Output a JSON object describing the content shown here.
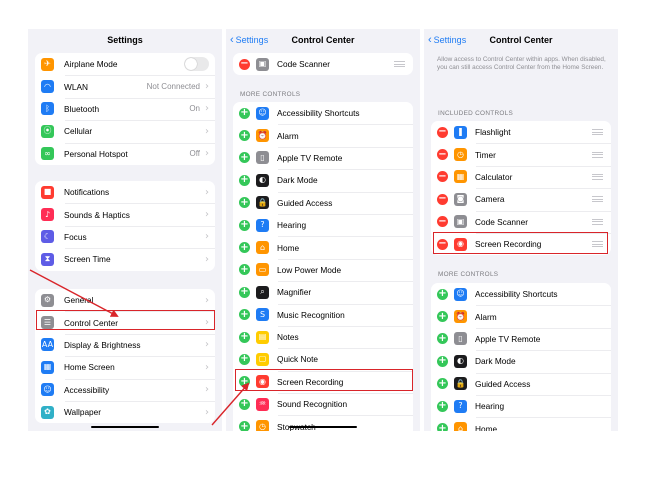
{
  "screen1": {
    "title": "Settings",
    "group1": [
      {
        "label": "Airplane Mode",
        "icon": "airplane-icon",
        "color": "#ff9500",
        "glyph": "✈",
        "toggle": true
      },
      {
        "label": "WLAN",
        "icon": "wifi-icon",
        "color": "#1f7cf4",
        "glyph": "◠",
        "value": "Not Connected"
      },
      {
        "label": "Bluetooth",
        "icon": "bluetooth-icon",
        "color": "#1f7cf4",
        "glyph": "ᛒ",
        "value": "On"
      },
      {
        "label": "Cellular",
        "icon": "cellular-icon",
        "color": "#34c759",
        "glyph": "⦿"
      },
      {
        "label": "Personal Hotspot",
        "icon": "hotspot-icon",
        "color": "#34c759",
        "glyph": "∞",
        "value": "Off"
      }
    ],
    "group2": [
      {
        "label": "Notifications",
        "icon": "notifications-icon",
        "color": "#ff3b30",
        "glyph": "■"
      },
      {
        "label": "Sounds & Haptics",
        "icon": "sounds-icon",
        "color": "#ff2d55",
        "glyph": "♪"
      },
      {
        "label": "Focus",
        "icon": "focus-icon",
        "color": "#5e5ce6",
        "glyph": "☾"
      },
      {
        "label": "Screen Time",
        "icon": "screen-time-icon",
        "color": "#5e5ce6",
        "glyph": "⧗"
      }
    ],
    "group3": [
      {
        "label": "General",
        "icon": "gear-icon",
        "color": "#8e8e93",
        "glyph": "⚙"
      },
      {
        "label": "Control Center",
        "icon": "control-center-icon",
        "color": "#8e8e93",
        "glyph": "☰"
      },
      {
        "label": "Display & Brightness",
        "icon": "display-icon",
        "color": "#1f7cf4",
        "glyph": "AA"
      },
      {
        "label": "Home Screen",
        "icon": "home-screen-icon",
        "color": "#1f7cf4",
        "glyph": "▦"
      },
      {
        "label": "Accessibility",
        "icon": "accessibility-icon",
        "color": "#1f7cf4",
        "glyph": "☺"
      },
      {
        "label": "Wallpaper",
        "icon": "wallpaper-icon",
        "color": "#30b0c7",
        "glyph": "✿"
      }
    ]
  },
  "screen2": {
    "back": "Settings",
    "title": "Control Center",
    "top_item": {
      "label": "Code Scanner",
      "icon": "code-scanner-icon",
      "color": "#8e8e93",
      "glyph": "▣"
    },
    "more_header": "MORE CONTROLS",
    "more": [
      {
        "label": "Accessibility Shortcuts",
        "icon": "accessibility-icon",
        "color": "#1f7cf4",
        "glyph": "☺"
      },
      {
        "label": "Alarm",
        "icon": "alarm-icon",
        "color": "#ff9500",
        "glyph": "⏰"
      },
      {
        "label": "Apple TV Remote",
        "icon": "tv-remote-icon",
        "color": "#8e8e93",
        "glyph": "▯"
      },
      {
        "label": "Dark Mode",
        "icon": "dark-mode-icon",
        "color": "#1c1c1e",
        "glyph": "◐"
      },
      {
        "label": "Guided Access",
        "icon": "lock-icon",
        "color": "#1c1c1e",
        "glyph": "🔒"
      },
      {
        "label": "Hearing",
        "icon": "ear-icon",
        "color": "#1f7cf4",
        "glyph": "?"
      },
      {
        "label": "Home",
        "icon": "home-icon",
        "color": "#ff9500",
        "glyph": "⌂"
      },
      {
        "label": "Low Power Mode",
        "icon": "battery-icon",
        "color": "#ff9500",
        "glyph": "▭"
      },
      {
        "label": "Magnifier",
        "icon": "magnifier-icon",
        "color": "#1c1c1e",
        "glyph": "⌕"
      },
      {
        "label": "Music Recognition",
        "icon": "music-recognition-icon",
        "color": "#1f7cf4",
        "glyph": "S"
      },
      {
        "label": "Notes",
        "icon": "notes-icon",
        "color": "#ffcc00",
        "glyph": "▤"
      },
      {
        "label": "Quick Note",
        "icon": "quick-note-icon",
        "color": "#ffcc00",
        "glyph": "▢"
      },
      {
        "label": "Screen Recording",
        "icon": "screen-recording-icon",
        "color": "#ff3b30",
        "glyph": "◉"
      },
      {
        "label": "Sound Recognition",
        "icon": "sound-recognition-icon",
        "color": "#ff2d55",
        "glyph": "♒"
      },
      {
        "label": "Stopwatch",
        "icon": "stopwatch-icon",
        "color": "#ff9500",
        "glyph": "◷"
      }
    ]
  },
  "screen3": {
    "back": "Settings",
    "title": "Control Center",
    "info": "Allow access to Control Center within apps. When disabled, you can still access Control Center from the Home Screen.",
    "included_header": "INCLUDED CONTROLS",
    "included": [
      {
        "label": "Flashlight",
        "icon": "flashlight-icon",
        "color": "#1f7cf4",
        "glyph": "❚"
      },
      {
        "label": "Timer",
        "icon": "timer-icon",
        "color": "#ff9500",
        "glyph": "◷"
      },
      {
        "label": "Calculator",
        "icon": "calculator-icon",
        "color": "#ff9500",
        "glyph": "▦"
      },
      {
        "label": "Camera",
        "icon": "camera-icon",
        "color": "#8e8e93",
        "glyph": "◙"
      },
      {
        "label": "Code Scanner",
        "icon": "code-scanner-icon",
        "color": "#8e8e93",
        "glyph": "▣"
      },
      {
        "label": "Screen Recording",
        "icon": "screen-recording-icon",
        "color": "#ff3b30",
        "glyph": "◉"
      }
    ],
    "more_header": "MORE CONTROLS",
    "more": [
      {
        "label": "Accessibility Shortcuts",
        "icon": "accessibility-icon",
        "color": "#1f7cf4",
        "glyph": "☺"
      },
      {
        "label": "Alarm",
        "icon": "alarm-icon",
        "color": "#ff9500",
        "glyph": "⏰"
      },
      {
        "label": "Apple TV Remote",
        "icon": "tv-remote-icon",
        "color": "#8e8e93",
        "glyph": "▯"
      },
      {
        "label": "Dark Mode",
        "icon": "dark-mode-icon",
        "color": "#1c1c1e",
        "glyph": "◐"
      },
      {
        "label": "Guided Access",
        "icon": "lock-icon",
        "color": "#1c1c1e",
        "glyph": "🔒"
      },
      {
        "label": "Hearing",
        "icon": "ear-icon",
        "color": "#1f7cf4",
        "glyph": "?"
      },
      {
        "label": "Home",
        "icon": "home-icon",
        "color": "#ff9500",
        "glyph": "⌂"
      }
    ]
  },
  "colors": {
    "accent": "#1f7cf4",
    "highlight": "#d9252a",
    "add": "#34c759",
    "remove": "#ff3b30"
  }
}
